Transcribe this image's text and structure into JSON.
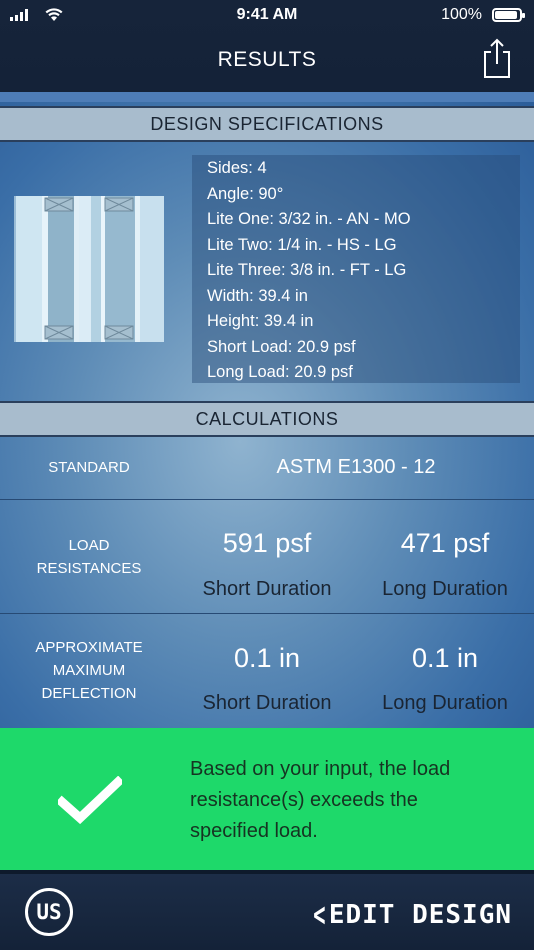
{
  "status": {
    "time": "9:41 AM",
    "battery": "100%",
    "battery_level": 1.0
  },
  "nav": {
    "title": "RESULTS",
    "share_icon": "share-icon"
  },
  "design": {
    "header": "DESIGN SPECIFICATIONS",
    "specs": [
      "Sides: 4",
      "Angle: 90°",
      "Lite One: 3/32 in. - AN - MO",
      "Lite Two: 1/4 in. - HS - LG",
      "Lite Three: 3/8 in. - FT - LG",
      "Width: 39.4 in",
      "Height: 39.4 in",
      "Short Load: 20.9 psf",
      "Long Load: 20.9 psf"
    ]
  },
  "calc": {
    "header": "CALCULATIONS",
    "standard_label": "STANDARD",
    "standard_value": "ASTM E1300 - 12",
    "load_label_1": "LOAD",
    "load_label_2": "RESISTANCES",
    "load_short_value": "591 psf",
    "load_long_value": "471 psf",
    "deflection_label_1": "APPROXIMATE",
    "deflection_label_2": "MAXIMUM",
    "deflection_label_3": "DEFLECTION",
    "deflection_short_value": "0.1 in",
    "deflection_long_value": "0.1 in",
    "short_caption": "Short Duration",
    "long_caption": "Long Duration"
  },
  "result": {
    "message_line1": "Based on your input, the load",
    "message_line2": "resistance(s) exceeds the",
    "message_line3": "specified load.",
    "color": "#1ed96a"
  },
  "footer": {
    "units_label": "US",
    "edit_label": "EDIT DESIGN"
  }
}
